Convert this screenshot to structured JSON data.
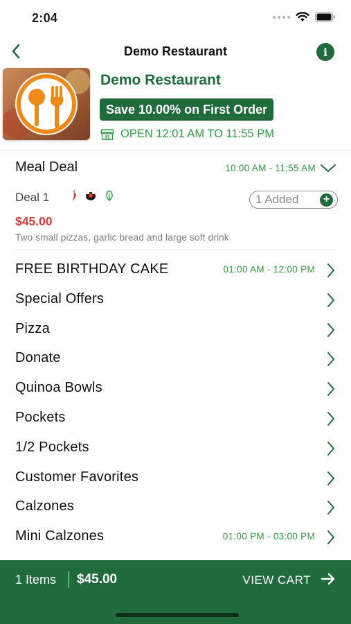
{
  "status_bar": {
    "time": "2:04"
  },
  "nav": {
    "title": "Demo Restaurant",
    "back_icon": "chevron-left-icon",
    "info_icon": "info-icon"
  },
  "restaurant": {
    "name": "Demo Restaurant",
    "promo": "Save 10.00% on First Order",
    "hours": "OPEN 12:01 AM TO 11:55 PM"
  },
  "meal_deal": {
    "title": "Meal Deal",
    "time": "10:00 AM - 11:55 AM",
    "item": {
      "name": "Deal 1",
      "added_label": "1 Added",
      "price": "$45.00",
      "description": "Two small pizzas, garlic bread and large soft drink"
    }
  },
  "categories": [
    {
      "label": "FREE BIRTHDAY CAKE",
      "time": "01:00 AM - 12:00 PM"
    },
    {
      "label": "Special Offers",
      "time": ""
    },
    {
      "label": "Pizza",
      "time": ""
    },
    {
      "label": "Donate",
      "time": ""
    },
    {
      "label": "Quinoa Bowls",
      "time": ""
    },
    {
      "label": "Pockets",
      "time": ""
    },
    {
      "label": "1/2 Pockets",
      "time": ""
    },
    {
      "label": "Customer Favorites",
      "time": ""
    },
    {
      "label": "Calzones",
      "time": ""
    },
    {
      "label": "Mini Calzones",
      "time": "01:00 PM - 03:00 PM"
    }
  ],
  "cart": {
    "count": "1 Items",
    "total": "$45.00",
    "view_label": "VIEW CART"
  },
  "colors": {
    "brand_green": "#1f6b3c",
    "accent_green": "#2d9e41",
    "price_red": "#e53935"
  }
}
